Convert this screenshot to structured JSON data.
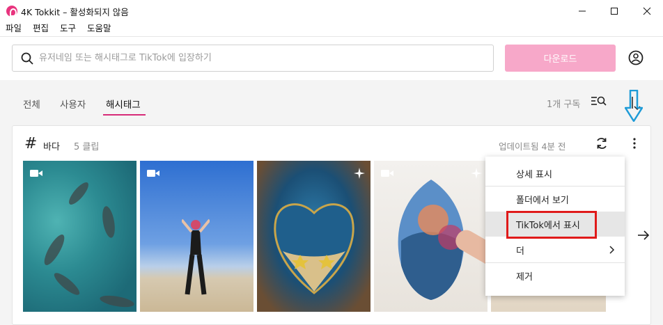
{
  "window": {
    "title": "4K Tokkit – 활성화되지 않음",
    "accent_color": "#e8347e"
  },
  "menu": [
    "파일",
    "편집",
    "도구",
    "도움말"
  ],
  "search": {
    "placeholder": "유저네임 또는 해시태그로 TikTok에 입장하기",
    "value": ""
  },
  "download_button": {
    "label": "다운로드",
    "color": "#f7a8c9"
  },
  "tabs": [
    {
      "label": "전체",
      "active": false
    },
    {
      "label": "사용자",
      "active": false
    },
    {
      "label": "해시태그",
      "active": true
    }
  ],
  "subscriptions": {
    "label": "1개 구독"
  },
  "card": {
    "hashtag": "바다",
    "clip_count": "5 클립",
    "updated": "업데이트됨 4분 전",
    "thumbnails": [
      {
        "icon": "video-camera-icon",
        "sparkle": false
      },
      {
        "icon": "video-camera-icon",
        "sparkle": false
      },
      {
        "icon": "",
        "sparkle": true
      },
      {
        "icon": "video-camera-icon",
        "sparkle": true
      },
      {
        "icon": "",
        "sparkle": false
      }
    ]
  },
  "context_menu": {
    "items": [
      {
        "label": "상세 표시"
      },
      {
        "label": "폴더에서 보기"
      },
      {
        "label": "TikTok에서 표시",
        "highlighted": true
      },
      {
        "label": "더",
        "submenu": true
      },
      {
        "label": "제거"
      }
    ]
  },
  "annotation": {
    "highlight_color": "#e01a1a",
    "arrow_color": "#1e9bd7"
  }
}
